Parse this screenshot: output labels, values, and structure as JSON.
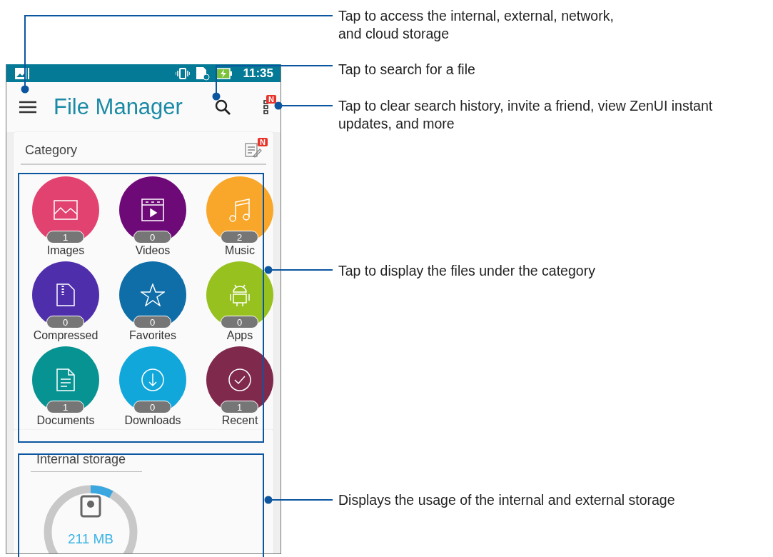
{
  "status_bar": {
    "time": "11:35"
  },
  "app_bar": {
    "title": "File Manager",
    "menu_badge": "N"
  },
  "category": {
    "title": "Category",
    "badge": "N",
    "items": [
      {
        "label": "Images",
        "count": "1",
        "color": "#e2426f",
        "kind": "images"
      },
      {
        "label": "Videos",
        "count": "0",
        "color": "#6e0a78",
        "kind": "videos"
      },
      {
        "label": "Music",
        "count": "2",
        "color": "#f9a72b",
        "kind": "music"
      },
      {
        "label": "Compressed",
        "count": "0",
        "color": "#4f2eac",
        "kind": "compressed"
      },
      {
        "label": "Favorites",
        "count": "0",
        "color": "#0f6ea8",
        "kind": "favorites"
      },
      {
        "label": "Apps",
        "count": "0",
        "color": "#96c11f",
        "kind": "apps"
      },
      {
        "label": "Documents",
        "count": "1",
        "color": "#079391",
        "kind": "documents"
      },
      {
        "label": "Downloads",
        "count": "0",
        "color": "#12a7da",
        "kind": "downloads"
      },
      {
        "label": "Recent",
        "count": "1",
        "color": "#7f294d",
        "kind": "recent"
      }
    ]
  },
  "storage": {
    "title": "Internal storage",
    "used": "211 MB",
    "level": 0.08
  },
  "callouts": [
    {
      "lines": [
        "Tap to access the internal, external, network,",
        "and cloud storage"
      ]
    },
    {
      "lines": [
        "Tap to search for a file"
      ]
    },
    {
      "lines": [
        "Tap to clear search history, invite a friend, view ZenUI instant",
        "updates, and more"
      ]
    },
    {
      "lines": [
        "Tap to display the files under the category"
      ]
    },
    {
      "lines": [
        "Displays the usage of the internal and external storage"
      ]
    }
  ]
}
